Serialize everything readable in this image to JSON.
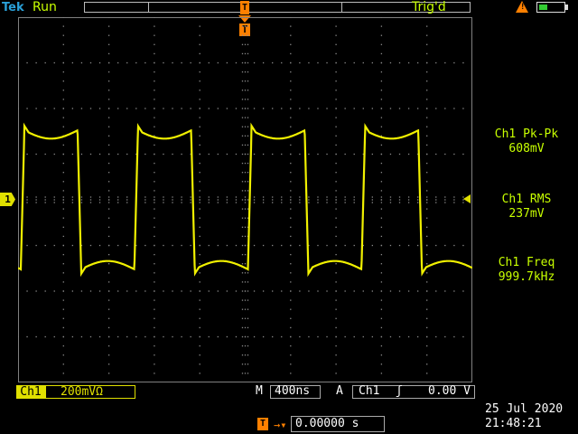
{
  "header": {
    "brand": "Tek",
    "acquisition_status": "Run",
    "trigger_status": "Trig'd",
    "warning_icon": "warning-triangle-icon",
    "battery_icon": "battery-icon"
  },
  "waveform": {
    "channel_label": "1",
    "trigger_marker": "T",
    "color": "#f0f000",
    "high_level_mv": 304,
    "low_level_mv": -304
  },
  "measurements": [
    {
      "label": "Ch1 Pk-Pk",
      "value": "608mV"
    },
    {
      "label": "Ch1 RMS",
      "value": "237mV"
    },
    {
      "label": "Ch1 Freq",
      "value": "999.7kHz"
    }
  ],
  "footer": {
    "channel": "Ch1",
    "vertical_scale": "200mV",
    "impedance_symbol": "Ω",
    "timebase_prefix": "M",
    "timebase": "400ns",
    "trigger_mode": "A",
    "trigger_source": "Ch1",
    "trigger_slope": "ʃ",
    "trigger_level": "0.00 V",
    "position_icon": "T",
    "position_arrow": "→▾",
    "horizontal_position": "0.00000 s",
    "date": "25 Jul  2020",
    "time": "21:48:21"
  },
  "colors": {
    "trace": "#f0f000",
    "status_text": "#c8ff00",
    "trigger": "#ff8000",
    "brand": "#2aa0d8"
  }
}
